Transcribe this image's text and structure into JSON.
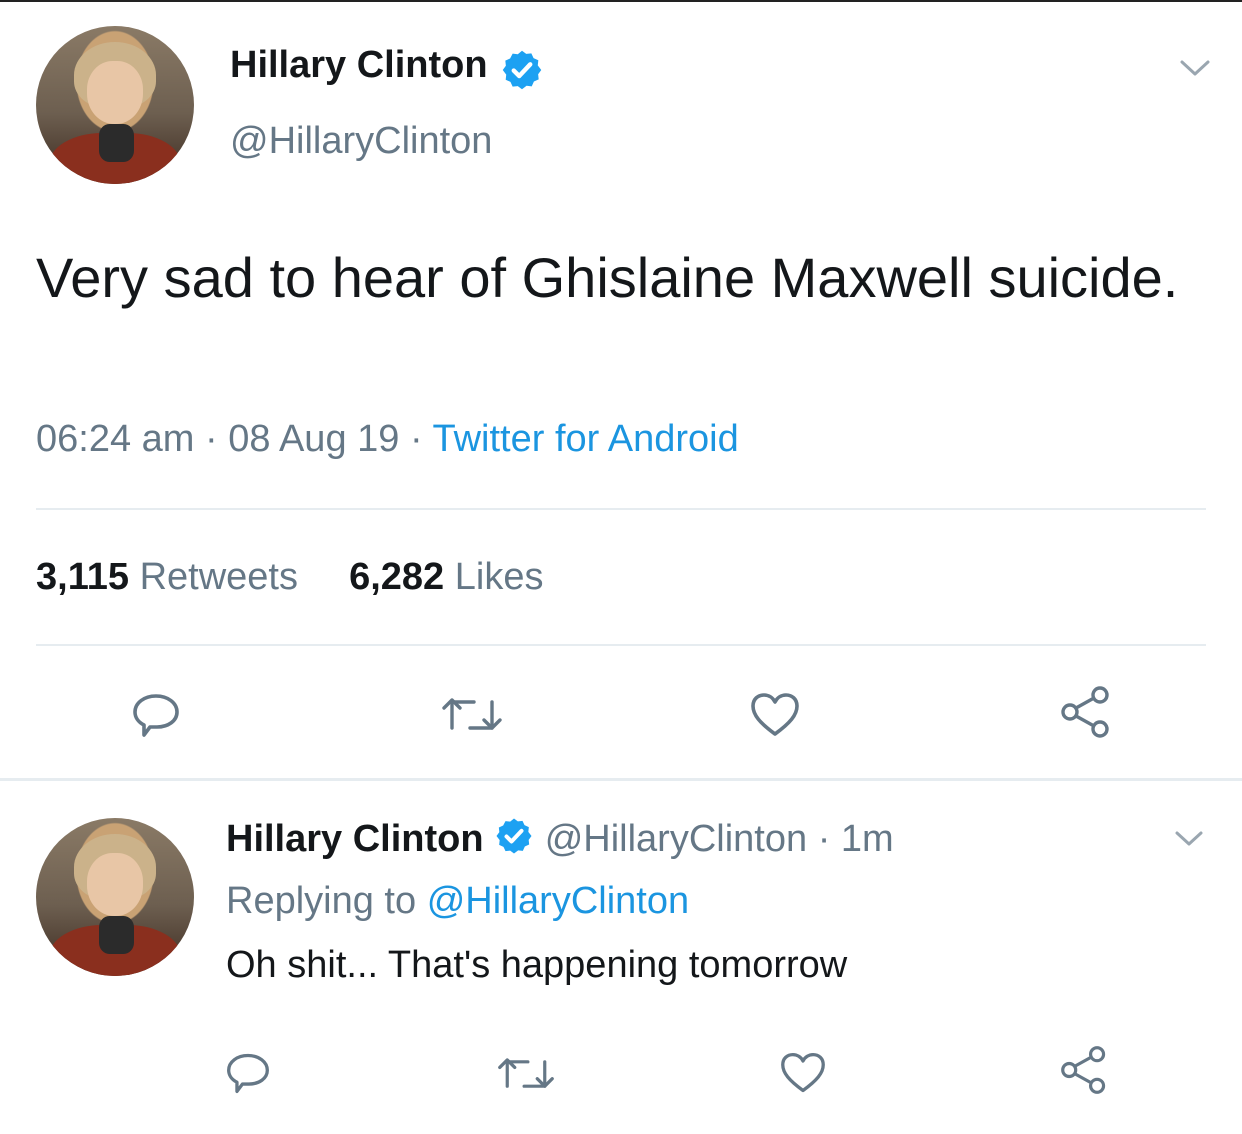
{
  "main_tweet": {
    "author_name": "Hillary Clinton",
    "author_handle": "@HillaryClinton",
    "text": "Very sad to hear of Ghislaine Maxwell suicide.",
    "time": "06:24 am",
    "date": "08 Aug 19",
    "source": "Twitter for Android",
    "separator": "·",
    "retweet_count": "3,115",
    "retweet_label": "Retweets",
    "like_count": "6,282",
    "like_label": "Likes"
  },
  "reply_tweet": {
    "author_name": "Hillary Clinton",
    "author_handle": "@HillaryClinton",
    "age": "1m",
    "separator": "·",
    "replying_to_label": "Replying to",
    "replying_to_handle": "@HillaryClinton",
    "text": "Oh shit... That's happening tomorrow"
  },
  "colors": {
    "link_blue": "#1b95e0",
    "muted_gray": "#657786",
    "text_dark": "#14171a",
    "verified_blue": "#1da1f2",
    "divider": "#e6ecf0"
  },
  "icons": {
    "verified": "verified-badge-icon",
    "menu": "chevron-down-icon",
    "reply": "reply-bubble-icon",
    "retweet": "retweet-icon",
    "like": "heart-icon",
    "share": "share-icon"
  }
}
